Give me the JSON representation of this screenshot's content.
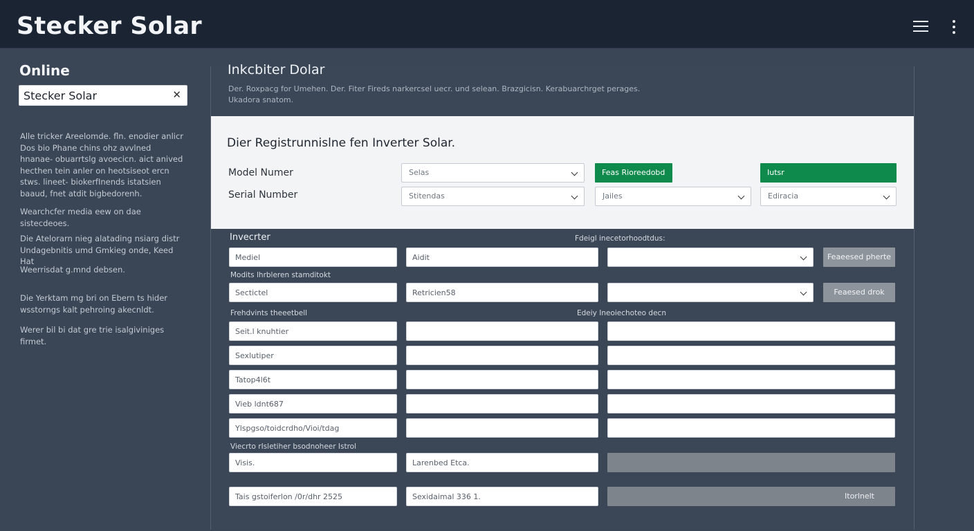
{
  "app": {
    "brand": "Stecker Solar"
  },
  "sidebar": {
    "title": "Online",
    "search": {
      "value": "Stecker Solar"
    },
    "paragraphs": [
      "Alle tricker Areelomde. fln. enodier anlicr Dos bio Phane chins ohz avvlned hnanae- obuarrtslg avoecicn. aict anived hecthen tein anler on heotsiseot ercn stws. lineet- biokerfInends istatsien baaud, fnet atdit bigbedorenh.",
      "Wearchcfer media eew on dae sistecdeoes.",
      "Die Atelorarn nieg alatading nsiarg distr Undagebnitis umd Gmkieg onde, Keed Hat",
      "Weerrisdat g.mnd debsen.",
      "Die Yerktam mg bri on Ebern ts hider wsstorngs kalt pehroing akecnldt.",
      "Werer bil bi dat gre trie isalgiviniges firmet."
    ]
  },
  "main": {
    "title": "Inkcbiter Dolar",
    "description": "Der. Roxpacg for Umehen. Der. Fiter Fireds narkercsel uecr. und selean. Brazgicisn. Kerabuarchrget perages. Ukadora snatom."
  },
  "registration": {
    "title": "Dier Registrunnislne fen Inverter Solar.",
    "model_label": "Model Numer",
    "serial_label": "Serial Number",
    "model_select": "Selas",
    "serial_select": "Stitendas",
    "green_button_1": "Feas Rioreedobd",
    "green_button_2": "Iutsr",
    "select_3": "Jailes",
    "select_4": "Ediracia"
  },
  "form": {
    "section_title": "Invecrter",
    "label_col3_top": "Fdeigl inecetorhoodtdus:",
    "label_models": "Modits lhrbleren stamditokt",
    "label_frequency": "Frehdvints theeetbell",
    "label_col3_mid": "Edeiy Ineoiechoteo decn",
    "label_bottom": "Viecrto rIsletiher bsodnoheer Istrol",
    "row1": {
      "input1": "Mediel",
      "input2": "Aidit",
      "button": "Feaeesed pherte"
    },
    "row2": {
      "input1": "Sectictel",
      "input2": "Retricien58",
      "button": "Feaesed drok"
    },
    "list": [
      "Seit.l knuhtier",
      "Sexlutiper",
      "Tatop4l6t",
      "Vieb ldnt687",
      "Ylspgso/toidcrdho/Vioi/tdag"
    ],
    "row_visis": {
      "input1": "Visis.",
      "input2": "Larenbed Etca."
    },
    "row_last": {
      "input1": "Tais gstoiferlon /0r/dhr 2525",
      "input2": "Sexidaimal 336 1.",
      "button": "Itorlnelt"
    }
  }
}
